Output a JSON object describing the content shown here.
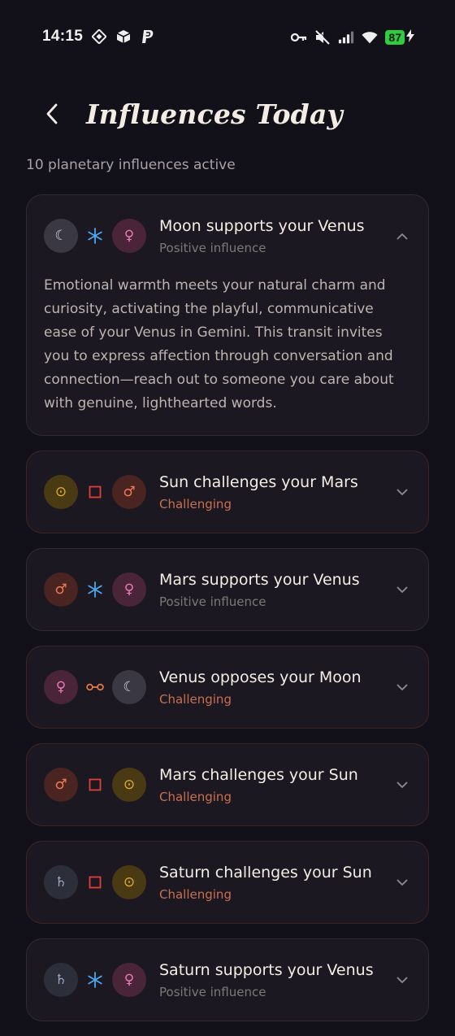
{
  "status": {
    "time": "14:15",
    "battery": "87"
  },
  "header": {
    "title": "Influences Today",
    "subtitle": "10 planetary influences active"
  },
  "glyphs": {
    "moon": "☾",
    "sun": "⊙",
    "mars": "♂",
    "venus": "♀",
    "saturn": "♄"
  },
  "colors": {
    "moon_bg": "#3a3842",
    "moon_fg": "#d5d2dc",
    "venus_bg": "#4a2539",
    "venus_fg": "#e77bb5",
    "sun_bg": "#4a3a14",
    "sun_fg": "#e6b22e",
    "mars_bg": "#4a2420",
    "mars_fg": "#ee7a55",
    "saturn_bg": "#2c2f3a",
    "saturn_fg": "#9aa7bd",
    "trine": "#4aa8f0",
    "square": "#e0403a",
    "opposition": "#e8783f"
  },
  "influences": [
    {
      "title": "Moon supports your Venus",
      "tag": "Positive influence",
      "tag_type": "positive",
      "left": "moon",
      "aspect": "sextile",
      "right": "venus",
      "expanded": true,
      "description": "Emotional warmth meets your natural charm and curiosity, activating the playful, communicative ease of your Venus in Gemini. This transit invites you to express affection through conversation and connection—reach out to someone you care about with genuine, lighthearted words."
    },
    {
      "title": "Sun challenges your Mars",
      "tag": "Challenging",
      "tag_type": "challenging",
      "left": "sun",
      "aspect": "square",
      "right": "mars",
      "expanded": false
    },
    {
      "title": "Mars supports your Venus",
      "tag": "Positive influence",
      "tag_type": "positive",
      "left": "mars",
      "aspect": "sextile",
      "right": "venus",
      "expanded": false
    },
    {
      "title": "Venus opposes your Moon",
      "tag": "Challenging",
      "tag_type": "challenging",
      "left": "venus",
      "aspect": "opposition",
      "right": "moon",
      "expanded": false
    },
    {
      "title": "Mars challenges your Sun",
      "tag": "Challenging",
      "tag_type": "challenging",
      "left": "mars",
      "aspect": "square",
      "right": "sun",
      "expanded": false
    },
    {
      "title": "Saturn challenges your Sun",
      "tag": "Challenging",
      "tag_type": "challenging",
      "left": "saturn",
      "aspect": "square",
      "right": "sun",
      "expanded": false
    },
    {
      "title": "Saturn supports your Venus",
      "tag": "Positive influence",
      "tag_type": "positive",
      "left": "saturn",
      "aspect": "sextile",
      "right": "venus",
      "expanded": false
    }
  ]
}
